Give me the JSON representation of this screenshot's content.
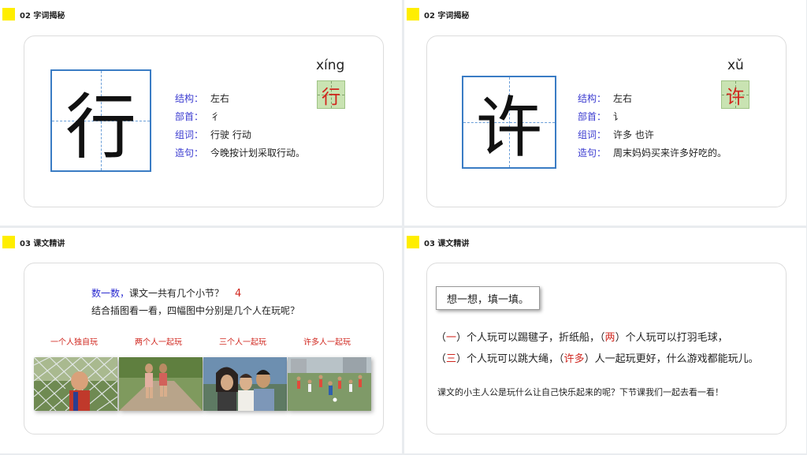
{
  "slide1": {
    "section": "02  字词揭秘",
    "character": "行",
    "pinyin": "xíng",
    "rows": [
      {
        "key": "结构：",
        "value": "左右"
      },
      {
        "key": "部首：",
        "value": "彳"
      },
      {
        "key": "组词：",
        "value": "行驶   行动"
      },
      {
        "key": "造句：",
        "value": "今晚按计划采取行动。"
      }
    ]
  },
  "slide2": {
    "section": "02  字词揭秘",
    "character": "许",
    "pinyin": "xǔ",
    "rows": [
      {
        "key": "结构：",
        "value": "左右"
      },
      {
        "key": "部首：",
        "value": "讠"
      },
      {
        "key": "组词：",
        "value": "许多   也许"
      },
      {
        "key": "造句：",
        "value": "周末妈妈买来许多好吃的。"
      }
    ]
  },
  "slide3": {
    "section": "03  课文精讲",
    "q1_prefix": "数一数，",
    "q1_text": "课文一共有几个小节？",
    "q1_answer": "4",
    "q2_text": "结合插图看一看，四幅图中分别是几个人在玩呢？",
    "labels": [
      "一个人独自玩",
      "两个人一起玩",
      "三个人一起玩",
      "许多人一起玩"
    ]
  },
  "slide4": {
    "section": "03  课文精讲",
    "title": "想一想，填一填。",
    "line1": {
      "a": "（",
      "b": "一",
      "c": "）个人玩可以踢毽子，折纸船，（",
      "d": "两",
      "e": "）个人玩可以打羽毛球，"
    },
    "line2": {
      "a": "（",
      "b": "三",
      "c": "）个人玩可以跳大绳，（",
      "d": "许多",
      "e": "）人一起玩更好，什么游戏都能玩儿。"
    },
    "summary": "课文的小主人公是玩什么让自己快乐起来的呢？下节课我们一起去看一看！"
  },
  "colors": {
    "accent_yellow": "#ffee00",
    "grid_blue": "#3a7cc4",
    "label_blue": "#3b3bd0",
    "answer_red": "#d0261e",
    "mini_green": "#c9e3b2"
  }
}
